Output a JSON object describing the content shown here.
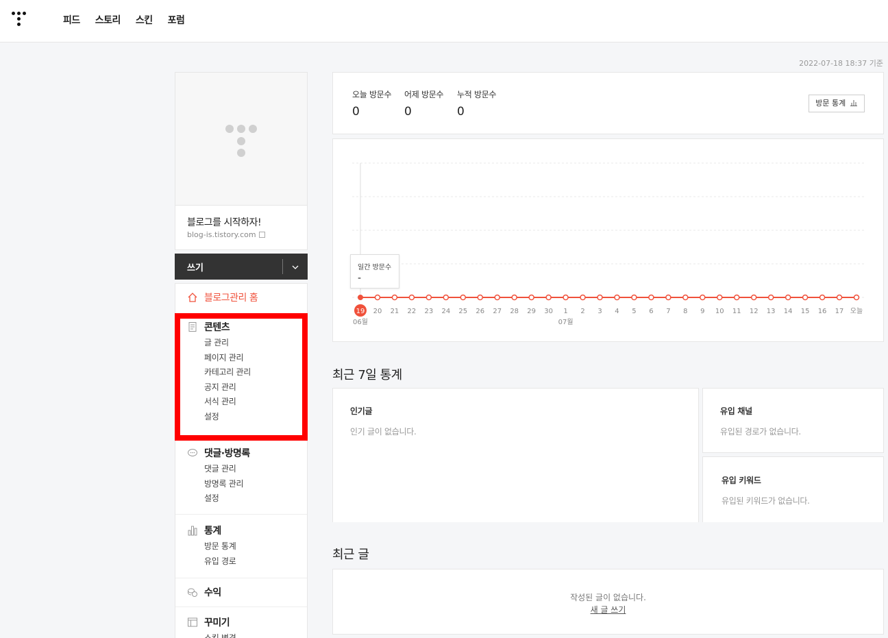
{
  "header": {
    "nav": [
      "피드",
      "스토리",
      "스킨",
      "포럼"
    ]
  },
  "timestamp": "2022-07-18 18:37 기준",
  "sidebar": {
    "blog_title": "블로그를 시작하자!",
    "blog_url": "blog-is.tistory.com",
    "write_label": "쓰기",
    "home_label": "블로그관리 홈",
    "sections": [
      {
        "title": "콘텐츠",
        "items": [
          "글 관리",
          "페이지 관리",
          "카테고리 관리",
          "공지 관리",
          "서식 관리",
          "설정"
        ]
      },
      {
        "title": "댓글·방명록",
        "items": [
          "댓글 관리",
          "방명록 관리",
          "설정"
        ]
      },
      {
        "title": "통계",
        "items": [
          "방문 통계",
          "유입 경로"
        ]
      },
      {
        "title": "수익",
        "items": []
      },
      {
        "title": "꾸미기",
        "items": [
          "스킨 변경"
        ]
      }
    ]
  },
  "stats": {
    "today_label": "오늘 방문수",
    "today_value": "0",
    "yesterday_label": "어제 방문수",
    "yesterday_value": "0",
    "total_label": "누적 방문수",
    "total_value": "0",
    "button_label": "방문 통계"
  },
  "chart_data": {
    "type": "line",
    "x": [
      "19",
      "20",
      "21",
      "22",
      "23",
      "24",
      "25",
      "26",
      "27",
      "28",
      "29",
      "30",
      "1",
      "2",
      "3",
      "4",
      "5",
      "6",
      "7",
      "8",
      "9",
      "10",
      "11",
      "12",
      "13",
      "14",
      "15",
      "16",
      "17",
      "오늘"
    ],
    "month_labels": [
      {
        "index": 0,
        "label": "06월"
      },
      {
        "index": 12,
        "label": "07월"
      }
    ],
    "series": [
      {
        "values": [
          0,
          0,
          0,
          0,
          0,
          0,
          0,
          0,
          0,
          0,
          0,
          0,
          0,
          0,
          0,
          0,
          0,
          0,
          0,
          0,
          0,
          0,
          0,
          0,
          0,
          0,
          0,
          0,
          0,
          0
        ]
      }
    ],
    "tooltip": {
      "label": "일간 방문수",
      "value": "-"
    },
    "color": "#f0513b",
    "grid": true
  },
  "recent7": {
    "title": "최근 7일 통계",
    "popular_title": "인기글",
    "popular_empty": "인기 글이 없습니다.",
    "channel_title": "유입 채널",
    "channel_empty": "유입된 경로가 없습니다.",
    "keyword_title": "유입 키워드",
    "keyword_empty": "유입된 키워드가 없습니다."
  },
  "recent_posts": {
    "title": "최근 글",
    "empty": "작성된 글이 없습니다.",
    "new_post": "새 글 쓰기"
  }
}
